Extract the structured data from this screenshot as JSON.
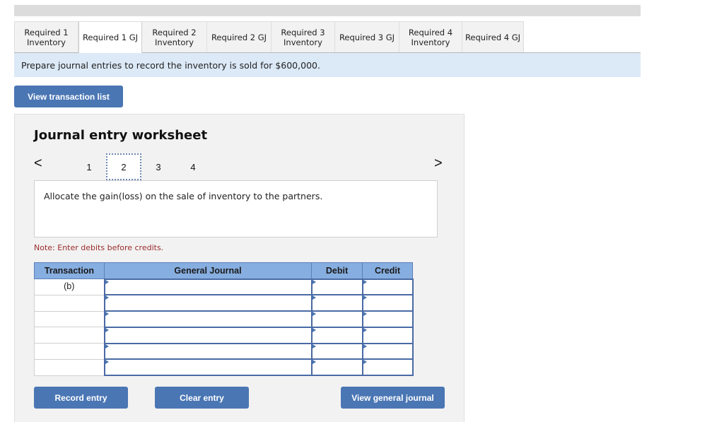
{
  "tabs": [
    {
      "label": "Required 1\nInventory",
      "active": false
    },
    {
      "label": "Required 1 GJ",
      "active": true
    },
    {
      "label": "Required 2\nInventory",
      "active": false
    },
    {
      "label": "Required 2 GJ",
      "active": false
    },
    {
      "label": "Required 3\nInventory",
      "active": false
    },
    {
      "label": "Required 3 GJ",
      "active": false
    },
    {
      "label": "Required 4\nInventory",
      "active": false
    },
    {
      "label": "Required 4 GJ",
      "active": false
    }
  ],
  "instruction": "Prepare journal entries to record the inventory is sold for $600,000.",
  "view_transaction_list_label": "View transaction list",
  "worksheet": {
    "title": "Journal entry worksheet",
    "prev_icon": "‹",
    "next_icon": "›",
    "pages": [
      "1",
      "2",
      "3",
      "4"
    ],
    "active_page": "2",
    "description": "Allocate the gain(loss) on the sale of inventory to the partners.",
    "note": "Note: Enter debits before credits.",
    "table": {
      "headers": {
        "transaction": "Transaction",
        "general_journal": "General Journal",
        "debit": "Debit",
        "credit": "Credit"
      },
      "rows": [
        {
          "transaction": "(b)",
          "account": "",
          "debit": "",
          "credit": ""
        },
        {
          "transaction": "",
          "account": "",
          "debit": "",
          "credit": ""
        },
        {
          "transaction": "",
          "account": "",
          "debit": "",
          "credit": ""
        },
        {
          "transaction": "",
          "account": "",
          "debit": "",
          "credit": ""
        },
        {
          "transaction": "",
          "account": "",
          "debit": "",
          "credit": ""
        },
        {
          "transaction": "",
          "account": "",
          "debit": "",
          "credit": ""
        }
      ]
    },
    "buttons": {
      "record": "Record entry",
      "clear": "Clear entry",
      "view_general_journal": "View general journal"
    }
  }
}
